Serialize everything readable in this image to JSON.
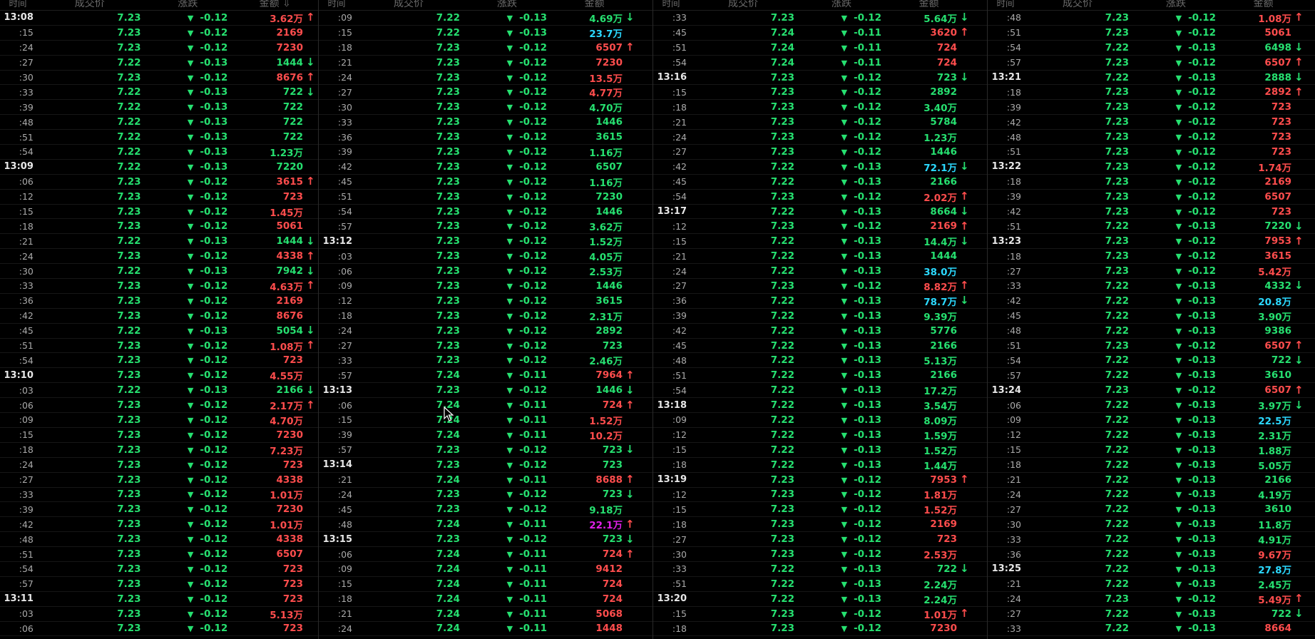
{
  "headers": {
    "time": "时间",
    "price": "成交价",
    "change": "涨跌",
    "amount": "金额",
    "amount_last": "金额 ⇩"
  },
  "colors": {
    "green": "#26e070",
    "red": "#ff4d4d",
    "cyan": "#2bd9ff",
    "magenta": "#e020e8",
    "background": "#000000",
    "time_text": "#aaaaaa"
  },
  "columns": [
    [
      [
        "13:08",
        "7.23",
        "-0.12",
        "3.62万",
        "r",
        "u"
      ],
      [
        ":15",
        "7.23",
        "-0.12",
        "2169",
        "r",
        ""
      ],
      [
        ":24",
        "7.23",
        "-0.12",
        "7230",
        "r",
        ""
      ],
      [
        ":27",
        "7.22",
        "-0.13",
        "1444",
        "g",
        "d"
      ],
      [
        ":30",
        "7.23",
        "-0.12",
        "8676",
        "r",
        "u"
      ],
      [
        ":33",
        "7.22",
        "-0.13",
        "722",
        "g",
        "d"
      ],
      [
        ":39",
        "7.22",
        "-0.13",
        "722",
        "g",
        ""
      ],
      [
        ":48",
        "7.22",
        "-0.13",
        "722",
        "g",
        ""
      ],
      [
        ":51",
        "7.22",
        "-0.13",
        "722",
        "g",
        ""
      ],
      [
        ":54",
        "7.22",
        "-0.13",
        "1.23万",
        "g",
        ""
      ],
      [
        "13:09",
        "7.22",
        "-0.13",
        "7220",
        "g",
        ""
      ],
      [
        ":06",
        "7.23",
        "-0.12",
        "3615",
        "r",
        "u"
      ],
      [
        ":12",
        "7.23",
        "-0.12",
        "723",
        "r",
        ""
      ],
      [
        ":15",
        "7.23",
        "-0.12",
        "1.45万",
        "r",
        ""
      ],
      [
        ":18",
        "7.23",
        "-0.12",
        "5061",
        "r",
        ""
      ],
      [
        ":21",
        "7.22",
        "-0.13",
        "1444",
        "g",
        "d"
      ],
      [
        ":24",
        "7.23",
        "-0.12",
        "4338",
        "r",
        "u"
      ],
      [
        ":30",
        "7.22",
        "-0.13",
        "7942",
        "g",
        "d"
      ],
      [
        ":33",
        "7.23",
        "-0.12",
        "4.63万",
        "r",
        "u"
      ],
      [
        ":36",
        "7.23",
        "-0.12",
        "2169",
        "r",
        ""
      ],
      [
        ":42",
        "7.23",
        "-0.12",
        "8676",
        "r",
        ""
      ],
      [
        ":45",
        "7.22",
        "-0.13",
        "5054",
        "g",
        "d"
      ],
      [
        ":51",
        "7.23",
        "-0.12",
        "1.08万",
        "r",
        "u"
      ],
      [
        ":54",
        "7.23",
        "-0.12",
        "723",
        "r",
        ""
      ],
      [
        "13:10",
        "7.23",
        "-0.12",
        "4.55万",
        "r",
        ""
      ],
      [
        ":03",
        "7.22",
        "-0.13",
        "2166",
        "g",
        "d"
      ],
      [
        ":06",
        "7.23",
        "-0.12",
        "2.17万",
        "r",
        "u"
      ],
      [
        ":09",
        "7.23",
        "-0.12",
        "4.70万",
        "r",
        ""
      ],
      [
        ":15",
        "7.23",
        "-0.12",
        "7230",
        "r",
        ""
      ],
      [
        ":18",
        "7.23",
        "-0.12",
        "7.23万",
        "r",
        ""
      ],
      [
        ":24",
        "7.23",
        "-0.12",
        "723",
        "r",
        ""
      ],
      [
        ":27",
        "7.23",
        "-0.12",
        "4338",
        "r",
        ""
      ],
      [
        ":33",
        "7.23",
        "-0.12",
        "1.01万",
        "r",
        ""
      ],
      [
        ":39",
        "7.23",
        "-0.12",
        "7230",
        "r",
        ""
      ],
      [
        ":42",
        "7.23",
        "-0.12",
        "1.01万",
        "r",
        ""
      ],
      [
        ":48",
        "7.23",
        "-0.12",
        "4338",
        "r",
        ""
      ],
      [
        ":51",
        "7.23",
        "-0.12",
        "6507",
        "r",
        ""
      ],
      [
        ":54",
        "7.23",
        "-0.12",
        "723",
        "r",
        ""
      ],
      [
        ":57",
        "7.23",
        "-0.12",
        "723",
        "r",
        ""
      ],
      [
        "13:11",
        "7.23",
        "-0.12",
        "723",
        "r",
        ""
      ],
      [
        ":03",
        "7.23",
        "-0.12",
        "5.13万",
        "r",
        ""
      ],
      [
        ":06",
        "7.23",
        "-0.12",
        "723",
        "r",
        ""
      ]
    ],
    [
      [
        ":09",
        "7.22",
        "-0.13",
        "4.69万",
        "g",
        "d"
      ],
      [
        ":15",
        "7.22",
        "-0.13",
        "23.7万",
        "cy",
        ""
      ],
      [
        ":18",
        "7.23",
        "-0.12",
        "6507",
        "r",
        "u"
      ],
      [
        ":21",
        "7.23",
        "-0.12",
        "7230",
        "r",
        ""
      ],
      [
        ":24",
        "7.23",
        "-0.12",
        "13.5万",
        "r",
        ""
      ],
      [
        ":27",
        "7.23",
        "-0.12",
        "4.77万",
        "r",
        ""
      ],
      [
        ":30",
        "7.23",
        "-0.12",
        "4.70万",
        "g",
        ""
      ],
      [
        ":33",
        "7.23",
        "-0.12",
        "1446",
        "g",
        ""
      ],
      [
        ":36",
        "7.23",
        "-0.12",
        "3615",
        "g",
        ""
      ],
      [
        ":39",
        "7.23",
        "-0.12",
        "1.16万",
        "g",
        ""
      ],
      [
        ":42",
        "7.23",
        "-0.12",
        "6507",
        "g",
        ""
      ],
      [
        ":45",
        "7.23",
        "-0.12",
        "1.16万",
        "g",
        ""
      ],
      [
        ":51",
        "7.23",
        "-0.12",
        "7230",
        "g",
        ""
      ],
      [
        ":54",
        "7.23",
        "-0.12",
        "1446",
        "g",
        ""
      ],
      [
        ":57",
        "7.23",
        "-0.12",
        "3.62万",
        "g",
        ""
      ],
      [
        "13:12",
        "7.23",
        "-0.12",
        "1.52万",
        "g",
        ""
      ],
      [
        ":03",
        "7.23",
        "-0.12",
        "4.05万",
        "g",
        ""
      ],
      [
        ":06",
        "7.23",
        "-0.12",
        "2.53万",
        "g",
        ""
      ],
      [
        ":09",
        "7.23",
        "-0.12",
        "1446",
        "g",
        ""
      ],
      [
        ":12",
        "7.23",
        "-0.12",
        "3615",
        "g",
        ""
      ],
      [
        ":18",
        "7.23",
        "-0.12",
        "2.31万",
        "g",
        ""
      ],
      [
        ":24",
        "7.23",
        "-0.12",
        "2892",
        "g",
        ""
      ],
      [
        ":27",
        "7.23",
        "-0.12",
        "723",
        "g",
        ""
      ],
      [
        ":33",
        "7.23",
        "-0.12",
        "2.46万",
        "g",
        ""
      ],
      [
        ":57",
        "7.24",
        "-0.11",
        "7964",
        "r",
        "u"
      ],
      [
        "13:13",
        "7.23",
        "-0.12",
        "1446",
        "g",
        "d"
      ],
      [
        ":06",
        "7.24",
        "-0.11",
        "724",
        "r",
        "u"
      ],
      [
        ":15",
        "7.24",
        "-0.11",
        "1.52万",
        "r",
        ""
      ],
      [
        ":39",
        "7.24",
        "-0.11",
        "10.2万",
        "r",
        ""
      ],
      [
        ":57",
        "7.23",
        "-0.12",
        "723",
        "g",
        "d"
      ],
      [
        "13:14",
        "7.23",
        "-0.12",
        "723",
        "g",
        ""
      ],
      [
        ":21",
        "7.24",
        "-0.11",
        "8688",
        "r",
        "u"
      ],
      [
        ":24",
        "7.23",
        "-0.12",
        "723",
        "g",
        "d"
      ],
      [
        ":45",
        "7.23",
        "-0.12",
        "9.18万",
        "g",
        ""
      ],
      [
        ":48",
        "7.24",
        "-0.11",
        "22.1万",
        "m",
        "u"
      ],
      [
        "13:15",
        "7.23",
        "-0.12",
        "723",
        "g",
        "d"
      ],
      [
        ":06",
        "7.24",
        "-0.11",
        "724",
        "r",
        "u"
      ],
      [
        ":09",
        "7.24",
        "-0.11",
        "9412",
        "r",
        ""
      ],
      [
        ":15",
        "7.24",
        "-0.11",
        "724",
        "r",
        ""
      ],
      [
        ":18",
        "7.24",
        "-0.11",
        "724",
        "r",
        ""
      ],
      [
        ":21",
        "7.24",
        "-0.11",
        "5068",
        "r",
        ""
      ],
      [
        ":24",
        "7.24",
        "-0.11",
        "1448",
        "r",
        ""
      ]
    ],
    [
      [
        ":33",
        "7.23",
        "-0.12",
        "5.64万",
        "g",
        "d"
      ],
      [
        ":45",
        "7.24",
        "-0.11",
        "3620",
        "r",
        "u"
      ],
      [
        ":51",
        "7.24",
        "-0.11",
        "724",
        "r",
        ""
      ],
      [
        ":54",
        "7.24",
        "-0.11",
        "724",
        "r",
        ""
      ],
      [
        "13:16",
        "7.23",
        "-0.12",
        "723",
        "g",
        "d"
      ],
      [
        ":15",
        "7.23",
        "-0.12",
        "2892",
        "g",
        ""
      ],
      [
        ":18",
        "7.23",
        "-0.12",
        "3.40万",
        "g",
        ""
      ],
      [
        ":21",
        "7.23",
        "-0.12",
        "5784",
        "g",
        ""
      ],
      [
        ":24",
        "7.23",
        "-0.12",
        "1.23万",
        "g",
        ""
      ],
      [
        ":27",
        "7.23",
        "-0.12",
        "1446",
        "g",
        ""
      ],
      [
        ":42",
        "7.22",
        "-0.13",
        "72.1万",
        "cy",
        "d"
      ],
      [
        ":45",
        "7.22",
        "-0.13",
        "2166",
        "g",
        ""
      ],
      [
        ":54",
        "7.23",
        "-0.12",
        "2.02万",
        "r",
        "u"
      ],
      [
        "13:17",
        "7.22",
        "-0.13",
        "8664",
        "g",
        "d"
      ],
      [
        ":12",
        "7.23",
        "-0.12",
        "2169",
        "r",
        "u"
      ],
      [
        ":15",
        "7.22",
        "-0.13",
        "14.4万",
        "g",
        "d"
      ],
      [
        ":21",
        "7.22",
        "-0.13",
        "1444",
        "g",
        ""
      ],
      [
        ":24",
        "7.22",
        "-0.13",
        "38.0万",
        "cy",
        ""
      ],
      [
        ":27",
        "7.23",
        "-0.12",
        "8.82万",
        "r",
        "u"
      ],
      [
        ":36",
        "7.22",
        "-0.13",
        "78.7万",
        "cy",
        "d"
      ],
      [
        ":39",
        "7.22",
        "-0.13",
        "9.39万",
        "g",
        ""
      ],
      [
        ":42",
        "7.22",
        "-0.13",
        "5776",
        "g",
        ""
      ],
      [
        ":45",
        "7.22",
        "-0.13",
        "2166",
        "g",
        ""
      ],
      [
        ":48",
        "7.22",
        "-0.13",
        "5.13万",
        "g",
        ""
      ],
      [
        ":51",
        "7.22",
        "-0.13",
        "2166",
        "g",
        ""
      ],
      [
        ":54",
        "7.22",
        "-0.13",
        "17.2万",
        "g",
        ""
      ],
      [
        "13:18",
        "7.22",
        "-0.13",
        "3.54万",
        "g",
        ""
      ],
      [
        ":09",
        "7.22",
        "-0.13",
        "8.09万",
        "g",
        ""
      ],
      [
        ":12",
        "7.22",
        "-0.13",
        "1.59万",
        "g",
        ""
      ],
      [
        ":15",
        "7.22",
        "-0.13",
        "1.52万",
        "g",
        ""
      ],
      [
        ":18",
        "7.22",
        "-0.13",
        "1.44万",
        "g",
        ""
      ],
      [
        "13:19",
        "7.23",
        "-0.12",
        "7953",
        "r",
        "u"
      ],
      [
        ":12",
        "7.23",
        "-0.12",
        "1.81万",
        "r",
        ""
      ],
      [
        ":15",
        "7.23",
        "-0.12",
        "1.52万",
        "r",
        ""
      ],
      [
        ":18",
        "7.23",
        "-0.12",
        "2169",
        "r",
        ""
      ],
      [
        ":27",
        "7.23",
        "-0.12",
        "723",
        "r",
        ""
      ],
      [
        ":30",
        "7.23",
        "-0.12",
        "2.53万",
        "r",
        ""
      ],
      [
        ":33",
        "7.22",
        "-0.13",
        "722",
        "g",
        "d"
      ],
      [
        ":51",
        "7.22",
        "-0.13",
        "2.24万",
        "g",
        ""
      ],
      [
        "13:20",
        "7.22",
        "-0.13",
        "2.24万",
        "g",
        ""
      ],
      [
        ":15",
        "7.23",
        "-0.12",
        "1.01万",
        "r",
        "u"
      ],
      [
        ":18",
        "7.23",
        "-0.12",
        "7230",
        "r",
        ""
      ]
    ],
    [
      [
        ":48",
        "7.23",
        "-0.12",
        "1.08万",
        "r",
        "u"
      ],
      [
        ":51",
        "7.23",
        "-0.12",
        "5061",
        "r",
        ""
      ],
      [
        ":54",
        "7.22",
        "-0.13",
        "6498",
        "g",
        "d"
      ],
      [
        ":57",
        "7.23",
        "-0.12",
        "6507",
        "r",
        "u"
      ],
      [
        "13:21",
        "7.22",
        "-0.13",
        "2888",
        "g",
        "d"
      ],
      [
        ":18",
        "7.23",
        "-0.12",
        "2892",
        "r",
        "u"
      ],
      [
        ":39",
        "7.23",
        "-0.12",
        "723",
        "r",
        ""
      ],
      [
        ":42",
        "7.23",
        "-0.12",
        "723",
        "r",
        ""
      ],
      [
        ":48",
        "7.23",
        "-0.12",
        "723",
        "r",
        ""
      ],
      [
        ":51",
        "7.23",
        "-0.12",
        "723",
        "r",
        ""
      ],
      [
        "13:22",
        "7.23",
        "-0.12",
        "1.74万",
        "r",
        ""
      ],
      [
        ":18",
        "7.23",
        "-0.12",
        "2169",
        "r",
        ""
      ],
      [
        ":39",
        "7.23",
        "-0.12",
        "6507",
        "r",
        ""
      ],
      [
        ":42",
        "7.23",
        "-0.12",
        "723",
        "r",
        ""
      ],
      [
        ":51",
        "7.22",
        "-0.13",
        "7220",
        "g",
        "d"
      ],
      [
        "13:23",
        "7.23",
        "-0.12",
        "7953",
        "r",
        "u"
      ],
      [
        ":18",
        "7.23",
        "-0.12",
        "3615",
        "r",
        ""
      ],
      [
        ":27",
        "7.23",
        "-0.12",
        "5.42万",
        "r",
        ""
      ],
      [
        ":33",
        "7.22",
        "-0.13",
        "4332",
        "g",
        "d"
      ],
      [
        ":42",
        "7.22",
        "-0.13",
        "20.8万",
        "cy",
        ""
      ],
      [
        ":45",
        "7.22",
        "-0.13",
        "3.90万",
        "g",
        ""
      ],
      [
        ":48",
        "7.22",
        "-0.13",
        "9386",
        "g",
        ""
      ],
      [
        ":51",
        "7.23",
        "-0.12",
        "6507",
        "r",
        "u"
      ],
      [
        ":54",
        "7.22",
        "-0.13",
        "722",
        "g",
        "d"
      ],
      [
        ":57",
        "7.22",
        "-0.13",
        "3610",
        "g",
        ""
      ],
      [
        "13:24",
        "7.23",
        "-0.12",
        "6507",
        "r",
        "u"
      ],
      [
        ":06",
        "7.22",
        "-0.13",
        "3.97万",
        "g",
        "d"
      ],
      [
        ":09",
        "7.22",
        "-0.13",
        "22.5万",
        "cy",
        ""
      ],
      [
        ":12",
        "7.22",
        "-0.13",
        "2.31万",
        "g",
        ""
      ],
      [
        ":15",
        "7.22",
        "-0.13",
        "1.88万",
        "g",
        ""
      ],
      [
        ":18",
        "7.22",
        "-0.13",
        "5.05万",
        "g",
        ""
      ],
      [
        ":21",
        "7.22",
        "-0.13",
        "2166",
        "g",
        ""
      ],
      [
        ":24",
        "7.22",
        "-0.13",
        "4.19万",
        "g",
        ""
      ],
      [
        ":27",
        "7.22",
        "-0.13",
        "3610",
        "g",
        ""
      ],
      [
        ":30",
        "7.22",
        "-0.13",
        "11.8万",
        "g",
        ""
      ],
      [
        ":33",
        "7.22",
        "-0.13",
        "4.91万",
        "g",
        ""
      ],
      [
        ":36",
        "7.22",
        "-0.13",
        "9.67万",
        "r",
        ""
      ],
      [
        "13:25",
        "7.22",
        "-0.13",
        "27.8万",
        "cy",
        ""
      ],
      [
        ":21",
        "7.22",
        "-0.13",
        "2.45万",
        "g",
        ""
      ],
      [
        ":24",
        "7.23",
        "-0.12",
        "5.49万",
        "r",
        "u"
      ],
      [
        ":27",
        "7.22",
        "-0.13",
        "722",
        "g",
        "d"
      ],
      [
        ":33",
        "7.22",
        "-0.13",
        "8664",
        "r",
        ""
      ]
    ]
  ]
}
